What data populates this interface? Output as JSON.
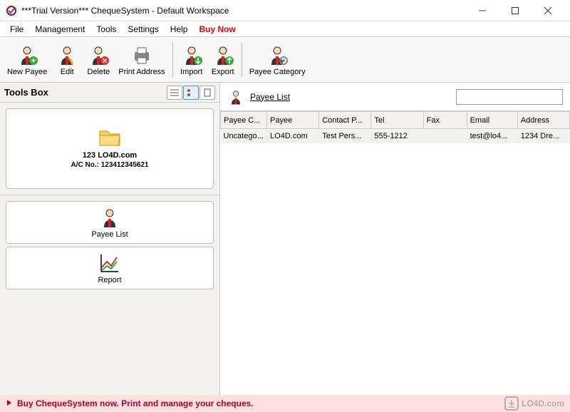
{
  "window": {
    "title": "***Trial Version*** ChequeSystem - Default Workspace"
  },
  "menu": {
    "file": "File",
    "management": "Management",
    "tools": "Tools",
    "settings": "Settings",
    "help": "Help",
    "buy_now": "Buy Now"
  },
  "toolbar": {
    "new_payee": "New Payee",
    "edit": "Edit",
    "delete": "Delete",
    "print_address": "Print Address",
    "import": "Import",
    "export": "Export",
    "payee_category": "Payee Category"
  },
  "toolsbox": {
    "title": "Tools Box",
    "account": {
      "name": "123 LO4D.com",
      "number_label": "A/C No.: 123412345621"
    },
    "nav": {
      "payee_list": "Payee List",
      "report": "Report"
    }
  },
  "right": {
    "title": "Payee List",
    "columns": {
      "payee_category": "Payee C...",
      "payee": "Payee",
      "contact_person": "Contact P...",
      "tel": "Tel",
      "fax": "Fax",
      "email": "Email",
      "address": "Address"
    },
    "rows": [
      {
        "payee_category": "Uncatego...",
        "payee": "LO4D.com",
        "contact_person": "Test Pers...",
        "tel": "555-1212",
        "fax": "",
        "email": "test@lo4...",
        "address": "1234 Dre..."
      }
    ]
  },
  "status": {
    "text": "Buy ChequeSystem now. Print and manage your cheques."
  },
  "watermark": "LO4D.com"
}
